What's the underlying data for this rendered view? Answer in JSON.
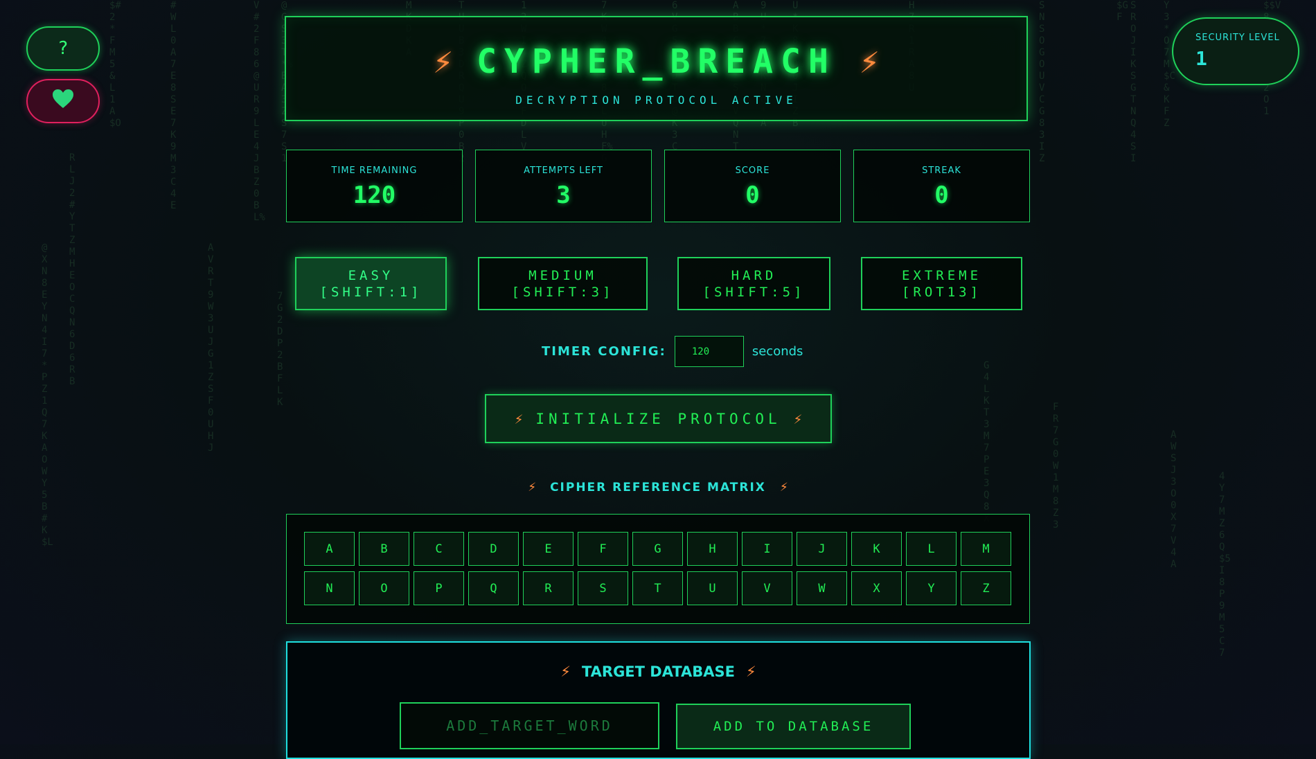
{
  "top_left": {
    "help_label": "?",
    "favorite_icon": "heart-icon"
  },
  "security": {
    "label": "SECURITY LEVEL",
    "value": "1"
  },
  "header": {
    "title": "CYPHER_BREACH",
    "subtitle": "DECRYPTION PROTOCOL ACTIVE",
    "bolt": "⚡"
  },
  "stats": [
    {
      "label": "TIME REMAINING",
      "value": "120"
    },
    {
      "label": "ATTEMPTS LEFT",
      "value": "3"
    },
    {
      "label": "SCORE",
      "value": "0"
    },
    {
      "label": "STREAK",
      "value": "0"
    }
  ],
  "difficulty": [
    {
      "name": "EASY",
      "shift": "[SHIFT:1]",
      "active": true
    },
    {
      "name": "MEDIUM",
      "shift": "[SHIFT:3]",
      "active": false
    },
    {
      "name": "HARD",
      "shift": "[SHIFT:5]",
      "active": false
    },
    {
      "name": "EXTREME",
      "shift": "[ROT13]",
      "active": false
    }
  ],
  "timer": {
    "label": "TIMER CONFIG:",
    "value": "120",
    "unit": "seconds"
  },
  "init_button": {
    "label": "INITIALIZE PROTOCOL"
  },
  "matrix": {
    "title": "CIPHER REFERENCE MATRIX",
    "letters": [
      "A",
      "B",
      "C",
      "D",
      "E",
      "F",
      "G",
      "H",
      "I",
      "J",
      "K",
      "L",
      "M",
      "N",
      "O",
      "P",
      "Q",
      "R",
      "S",
      "T",
      "U",
      "V",
      "W",
      "X",
      "Y",
      "Z"
    ]
  },
  "database": {
    "title": "TARGET DATABASE",
    "input_placeholder": "ADD_TARGET_WORD",
    "add_label": "ADD TO DATABASE"
  },
  "colors": {
    "neon_green": "#22ff66",
    "cyan": "#2ce4d8",
    "bolt_orange": "#ff8a3d",
    "alert_pink": "#e0205e"
  }
}
